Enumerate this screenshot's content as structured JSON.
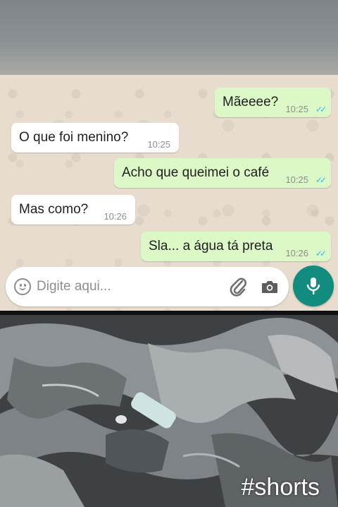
{
  "messages": [
    {
      "direction": "out",
      "text": "Mãeeee?",
      "time": "10:25",
      "status": "read"
    },
    {
      "direction": "in",
      "text": "O que foi menino?",
      "time": "10:25"
    },
    {
      "direction": "out",
      "text": "Acho que queimei o café",
      "time": "10:25",
      "status": "read"
    },
    {
      "direction": "in",
      "text": "Mas como?",
      "time": "10:26"
    },
    {
      "direction": "out",
      "text": "Sla... a água tá preta",
      "time": "10:26",
      "status": "read"
    }
  ],
  "composer": {
    "placeholder": "Digite aqui...",
    "icons": [
      "emoji-icon",
      "paperclip-icon",
      "camera-icon",
      "microphone-icon"
    ]
  },
  "overlay": {
    "tag": "#shorts"
  },
  "colors": {
    "outgoing_bubble": "#dcf8c6",
    "incoming_bubble": "#ffffff",
    "read_ticks": "#34b7f1",
    "mic_button": "#128c7e",
    "chat_background": "#e7dccd"
  }
}
